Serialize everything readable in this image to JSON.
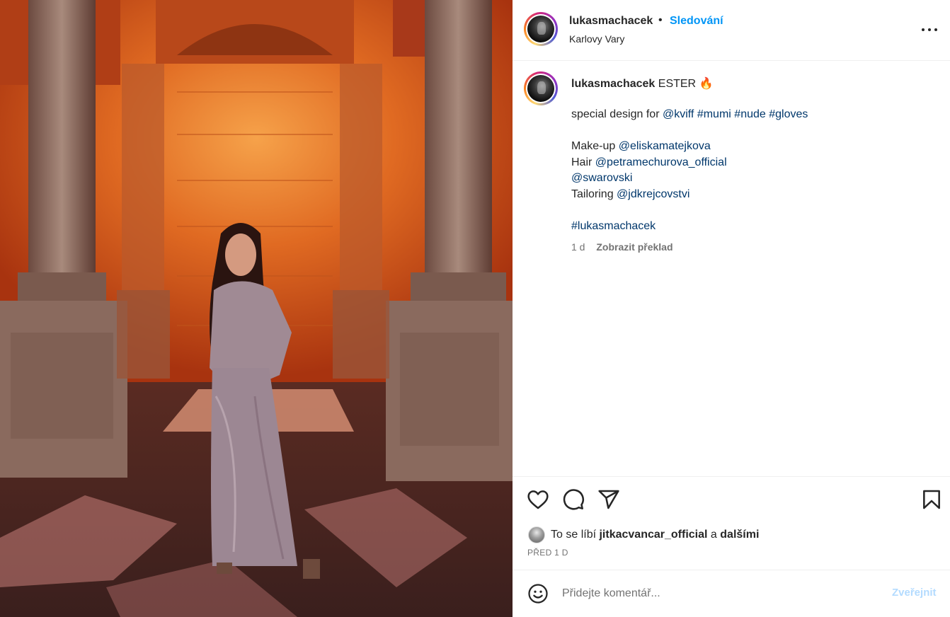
{
  "post": {
    "image_alt": "Woman in a long grey dress standing between columns in an orange-lit marble hall"
  },
  "header": {
    "username": "lukasmachacek",
    "separator": "•",
    "follow_label": "Sledování",
    "location": "Karlovy Vary",
    "more_icon": "more-horizontal-icon"
  },
  "caption": {
    "username": "lukasmachacek",
    "title_text": "ESTER",
    "title_emoji": "🔥",
    "line1_prefix": "special design for",
    "line1_mention": "@kviff",
    "line1_tags": [
      "#mumi",
      "#nude",
      "#gloves"
    ],
    "makeup_label": "Make-up",
    "makeup_mention": "@eliskamatejkova",
    "hair_label": "Hair",
    "hair_mention": "@petramechurova_official",
    "swarovski_mention": "@swarovski",
    "tailoring_label": "Tailoring",
    "tailoring_mention": "@jdkrejcovstvi",
    "final_tag": "#lukasmachacek",
    "age": "1 d",
    "translate_label": "Zobrazit překlad"
  },
  "actions": {
    "like_icon": "heart-icon",
    "comment_icon": "comment-icon",
    "share_icon": "send-icon",
    "save_icon": "bookmark-icon",
    "likes_prefix": "To se líbí",
    "likes_user": "jitkacvancar_official",
    "likes_conjunction": "a",
    "likes_others": "dalšími",
    "date": "PŘED 1 D"
  },
  "comment": {
    "emoji_icon": "smiley-icon",
    "placeholder": "Přidejte komentář...",
    "post_label": "Zveřejnit"
  },
  "colors": {
    "accent": "#0095f6",
    "link": "#00376b",
    "muted": "#737373",
    "post_disabled": "#b3dbff",
    "divider": "#efefef"
  }
}
